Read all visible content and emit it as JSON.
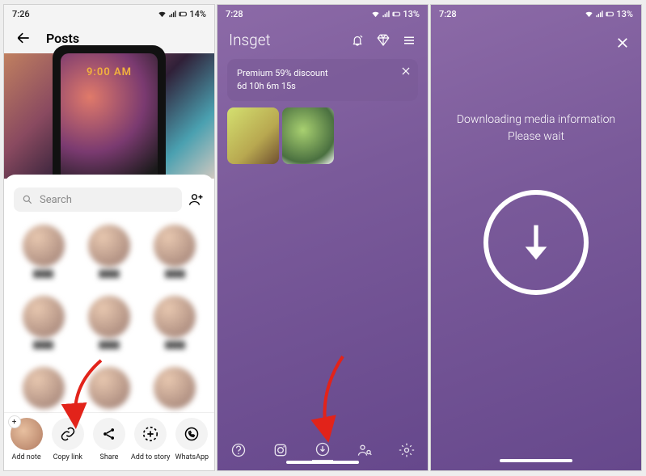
{
  "frame1": {
    "status": {
      "time": "7:26",
      "battery": "14%"
    },
    "titlebar": {
      "title": "Posts"
    },
    "post_time_overlay": "9:00 AM",
    "sheet": {
      "search_placeholder": "Search",
      "actions": {
        "add_note": "Add note",
        "copy_link": "Copy link",
        "share": "Share",
        "add_story": "Add to story",
        "whatsapp": "WhatsApp"
      }
    }
  },
  "frame2": {
    "status": {
      "time": "7:28",
      "battery": "13%"
    },
    "app_title": "Insget",
    "promo": {
      "line1": "Premium 59% discount",
      "line2": "6d 10h 6m 15s"
    }
  },
  "frame3": {
    "status": {
      "time": "7:28",
      "battery": "13%"
    },
    "message_line1": "Downloading media information",
    "message_line2": "Please wait"
  }
}
